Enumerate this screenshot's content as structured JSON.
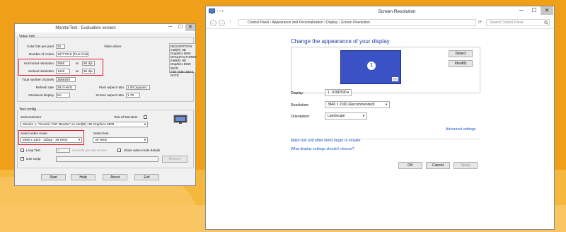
{
  "monitortest": {
    "title": "MonitorTest - Evaluation version",
    "window_controls": {
      "minimize": "─",
      "maximize": "☐",
      "close": "✕"
    },
    "video_info": {
      "label": "Video Info",
      "color_bits_label": "Color bits per pixel",
      "color_bits_value": "32",
      "num_colors_label": "Number of colors",
      "num_colors_value": "16777216 (True Color)",
      "video_driver_label": "Video driver",
      "driver_text_lines": [
        "DESCRIPTION:",
        "Intel(R) HD Graphics 5500",
        "MANUFACTURER:",
        "Intel(R) HD Graphics 5500",
        "BIOS:",
        "Intel Video BIOS",
        "DATE:"
      ],
      "hres_label": "Horizontal resolution",
      "hres_value": "2560",
      "hres_at": "at",
      "hres_dpi": "96 dpi",
      "vres_label": "Vertical resolution",
      "vres_value": "1440",
      "vres_at": "at",
      "vres_dpi": "96 dpi",
      "total_pixels_label": "Total number of pixels",
      "total_pixels_value": "3686400",
      "refresh_label": "Refresh rate",
      "refresh_value": "29.0 Hertz",
      "pixel_aspect_label": "Pixel aspect ratio",
      "pixel_aspect_value": "1.00 (square)",
      "interlaced_label": "Interlaced display",
      "interlaced_value": "No",
      "screen_aspect_label": "Screen aspect ratio",
      "screen_aspect_value": "1.78"
    },
    "test_config": {
      "label": "Test config",
      "select_monitor_label": "Select Monitor",
      "test_all_label": "Test All Monitors",
      "monitor_value": "Monitor 1, \"Generic PnP Monitor\" on Intel(R) HD Graphics 5500",
      "video_mode_label": "Select video mode",
      "video_mode_value": "2560 x 1440 - 32bpp - 29 Hertz",
      "select_test_label": "Select test",
      "select_test_value": "All Tests",
      "loop_test_label": "Loop Test",
      "loop_seconds_value": "3",
      "loop_seconds_suffix": "seconds per test screen",
      "show_details_label": "Show video mode details",
      "use_script_label": "Use script",
      "browse_label": "Browse"
    },
    "buttons": {
      "start": "Start",
      "help": "Help",
      "about": "About",
      "exit": "Exit"
    }
  },
  "control_panel": {
    "title": "Screen Resolution",
    "window_controls": {
      "minimize": "─",
      "maximize": "☐",
      "close": "✕"
    },
    "nav": {
      "back": "←",
      "forward": "→",
      "up": "↑",
      "refresh": "⟳"
    },
    "breadcrumb": "Control Panel  ›  Appearance and Personalization  ›  Display  ›  Screen Resolution",
    "search_placeholder": "Search Control Panel",
    "heading": "Change the appearance of your display",
    "monitor_number": "1",
    "detect_label": "Detect",
    "identify_label": "Identify",
    "display_label": "Display:",
    "display_value": "1. U28D590",
    "resolution_label": "Resolution:",
    "resolution_value": "3840 × 2160 (Recommended)",
    "orientation_label": "Orientation:",
    "orientation_value": "Landscape",
    "advanced_settings": "Advanced settings",
    "link_text_size": "Make text and other items larger or smaller",
    "link_which_settings": "What display settings should I choose?",
    "ok_label": "OK",
    "cancel_label": "Cancel",
    "apply_label": "Apply"
  },
  "colors": {
    "desktop_orange": "#f0a018",
    "highlight_red": "#e21b2c",
    "monitor_blue": "#3b52c4",
    "link_blue": "#1a57c8",
    "heading_blue": "#1e3f9e"
  }
}
